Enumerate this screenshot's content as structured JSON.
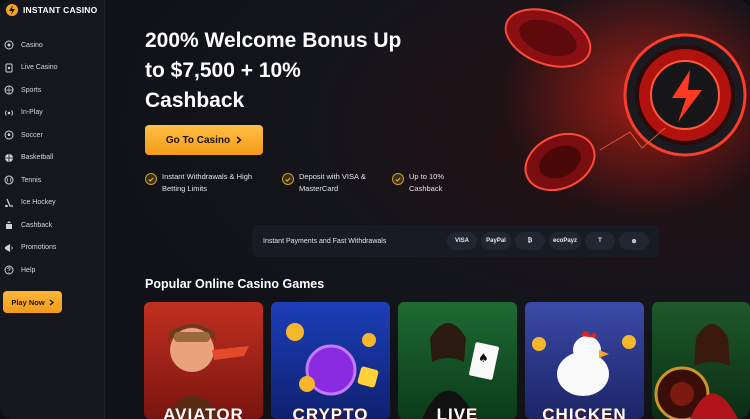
{
  "brand": {
    "name": "INSTANT CASINO",
    "accent": "#f5a623"
  },
  "sidebar": {
    "items": [
      {
        "label": "Casino",
        "icon": "casino-icon"
      },
      {
        "label": "Live Casino",
        "icon": "live-casino-icon"
      },
      {
        "label": "Sports",
        "icon": "sports-icon"
      },
      {
        "label": "In-Play",
        "icon": "in-play-icon"
      },
      {
        "label": "Soccer",
        "icon": "soccer-icon"
      },
      {
        "label": "Basketball",
        "icon": "basketball-icon"
      },
      {
        "label": "Tennis",
        "icon": "tennis-icon"
      },
      {
        "label": "Ice Hockey",
        "icon": "ice-hockey-icon"
      },
      {
        "label": "Cashback",
        "icon": "cashback-icon"
      },
      {
        "label": "Promotions",
        "icon": "promotions-icon"
      },
      {
        "label": "Help",
        "icon": "help-icon"
      }
    ],
    "play_label": "Play Now"
  },
  "hero": {
    "title": "200% Welcome Bonus Up to $7,500 + 10% Cashback",
    "cta_label": "Go To Casino",
    "features": [
      "Instant Withdrawals & High Betting Limits",
      "Deposit with VISA & MasterCard",
      "Up to 10% Cashback"
    ]
  },
  "payments": {
    "label": "Instant Payments and Fast Withdrawals",
    "methods": [
      "VISA",
      "PayPal",
      "₿",
      "ecoPayz",
      "T",
      "⊛"
    ]
  },
  "games": {
    "title": "Popular Online Casino Games",
    "items": [
      {
        "title": "AVIATOR"
      },
      {
        "title": "CRYPTO"
      },
      {
        "title": "LIVE"
      },
      {
        "title": "CHICKEN"
      },
      {
        "title": ""
      }
    ]
  }
}
